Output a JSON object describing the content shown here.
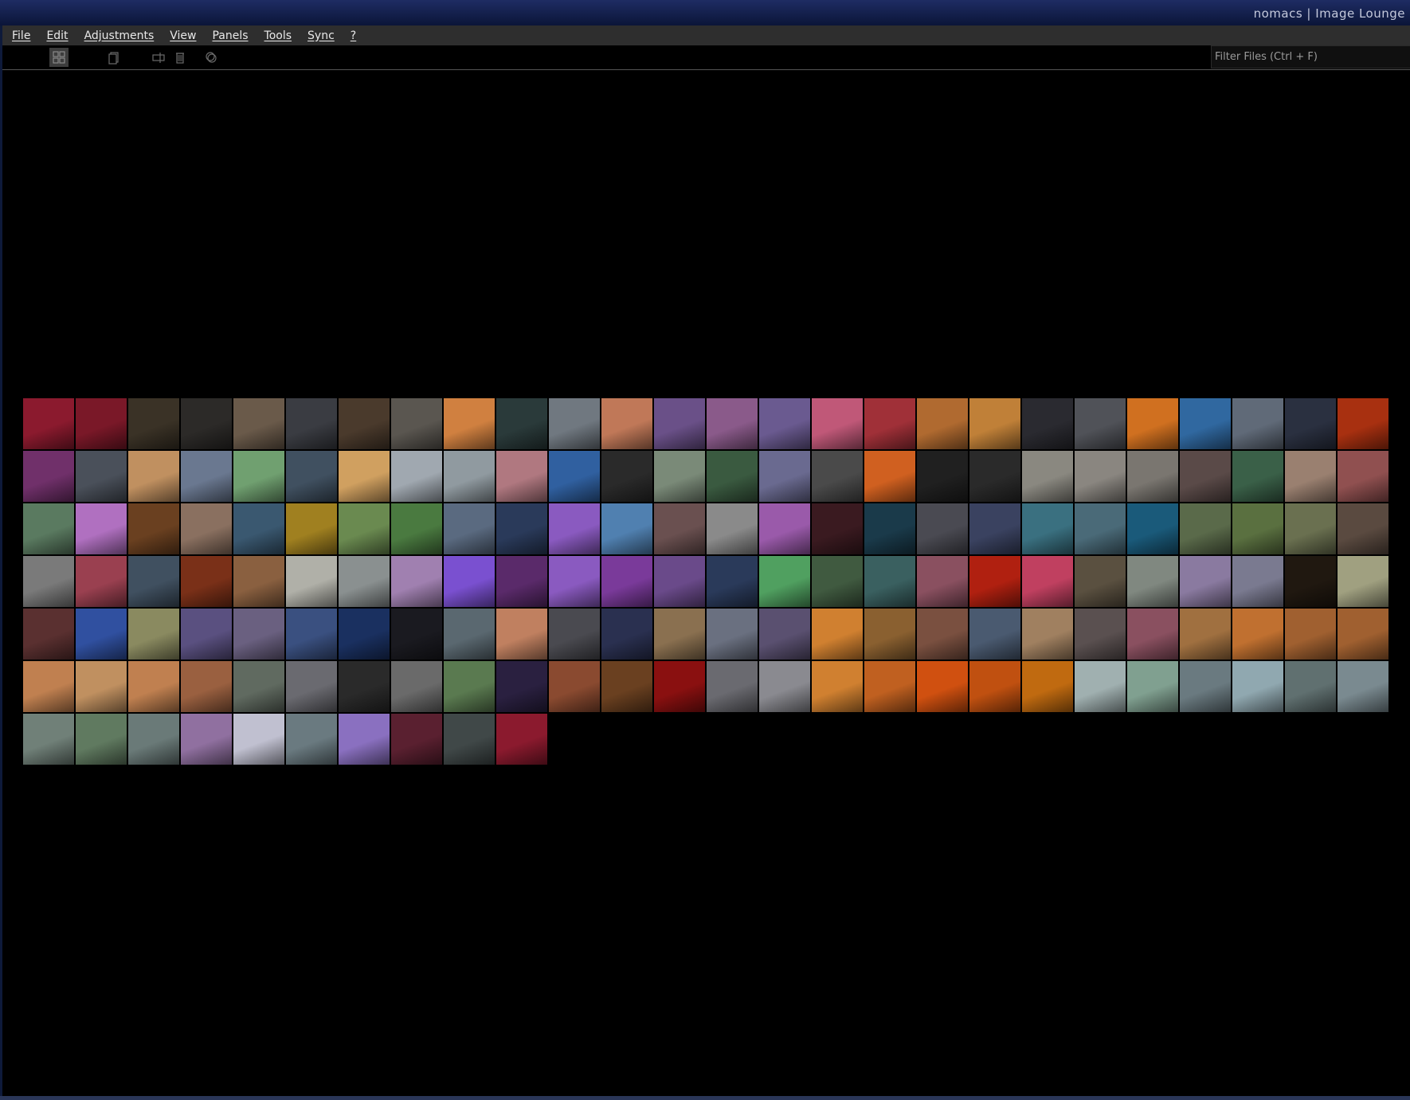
{
  "window": {
    "title": "nomacs  |  Image Lounge"
  },
  "menu": {
    "items": [
      {
        "label": "File"
      },
      {
        "label": "Edit"
      },
      {
        "label": "Adjustments"
      },
      {
        "label": "View"
      },
      {
        "label": "Panels"
      },
      {
        "label": "Tools"
      },
      {
        "label": "Sync"
      },
      {
        "label": "?"
      }
    ]
  },
  "toolbar": {
    "icons": [
      "grid-view-icon",
      "copy-icon",
      "rename-icon",
      "delete-icon",
      "tag-icon"
    ],
    "filter_placeholder": "Filter Files (Ctrl + F)"
  },
  "thumbnails": {
    "columns": 26,
    "count": 166,
    "colors": [
      "#8b1a2e",
      "#7a1828",
      "#3a3226",
      "#2c2a28",
      "#6a5a4a",
      "#3a3c42",
      "#4a3a2c",
      "#5a5650",
      "#d08040",
      "#2a3a3a",
      "#707880",
      "#c07858",
      "#6a5088",
      "#8a5a8a",
      "#6a5a90",
      "#c05878",
      "#a03038",
      "#b06a30",
      "#c08038",
      "#2a2a30",
      "#505258",
      "#d07020",
      "#3068a0",
      "#606a78",
      "#2a3040",
      "#a83010",
      "#70306a",
      "#4a505a",
      "#c09060",
      "#6a7890",
      "#70a070",
      "#405060",
      "#d0a060",
      "#a0a8b0",
      "#909aa0",
      "#b07880",
      "#3060a0",
      "#2a2a2a",
      "#7a8a78",
      "#3a5a40",
      "#6a6a90",
      "#4a4a4a",
      "#d06020",
      "#202020",
      "#2a2a2a",
      "#8a8880",
      "#8a8680",
      "#7a7670",
      "#5a4a48",
      "#3a6048",
      "#9a8070",
      "#905050",
      "#5a7a60",
      "#b070c0",
      "#6a4020",
      "#8a7060",
      "#3a5870",
      "#a08020",
      "#6a8a50",
      "#4a7a40",
      "#5a6a80",
      "#2a3a5a",
      "#8a5ac0",
      "#5080b0",
      "#6a5050",
      "#8a8a8a",
      "#9a5aaa",
      "#3a1a20",
      "#1a3a4a",
      "#4a4a52",
      "#3a4260",
      "#3a7080",
      "#4a6a78",
      "#1a5a7a",
      "#5a6a4a",
      "#5a7040",
      "#6a7050",
      "#5a4a40",
      "#7a7a7a",
      "#9a4050",
      "#405060",
      "#7a3018",
      "#8a6040",
      "#b0b0a8",
      "#8a9090",
      "#a080b0",
      "#7a50d0",
      "#5a2a6a",
      "#8a5ac0",
      "#7a3a9a",
      "#6a4a8a",
      "#2a3a5a",
      "#50a060",
      "#405a40",
      "#3a6060",
      "#8a5060",
      "#b02010",
      "#c04060",
      "#5a5040",
      "#808880",
      "#8a7aa0",
      "#7a7a90",
      "#201810",
      "#a0a080",
      "#5a3030",
      "#3050a0",
      "#8a8a60",
      "#5a5080",
      "#6a6080",
      "#3a5080",
      "#1a3060",
      "#1a1a20",
      "#5a6870",
      "#c08060",
      "#4a4a50",
      "#2a3050",
      "#8a7050",
      "#6a7080",
      "#5a5070",
      "#d08030",
      "#8a6030",
      "#7a5040",
      "#4a5a70",
      "#a08060",
      "#5a5050",
      "#8a5060",
      "#a07040",
      "#c07030",
      "#a06030",
      "#a06030",
      "#c08050",
      "#c09060",
      "#c08050",
      "#9a6040",
      "#606a60",
      "#6a6a70",
      "#2a2a2a",
      "#6a6a6a",
      "#5a7a50",
      "#2a2040",
      "#8a4a30",
      "#6a4020",
      "#8a1010",
      "#6a6a70",
      "#8a8a90",
      "#d08030",
      "#c06020",
      "#d05010",
      "#c05010",
      "#c06a10",
      "#a0b0b0",
      "#80a090",
      "#6a7a80",
      "#90a8b0",
      "#607070",
      "#7a8a90",
      "#708078",
      "#607a60",
      "#6a7a78",
      "#9070a0",
      "#c0c0d0",
      "#6a7a80",
      "#8a70c0",
      "#5a2030",
      "#404848"
    ]
  }
}
